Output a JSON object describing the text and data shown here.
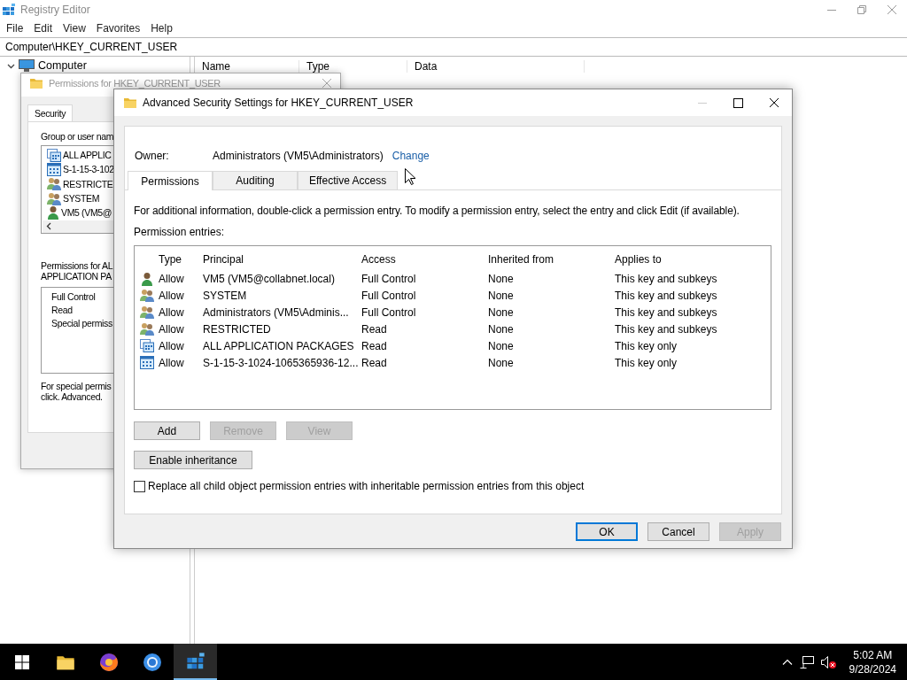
{
  "registry_editor": {
    "title": "Registry Editor",
    "menu": [
      "File",
      "Edit",
      "View",
      "Favorites",
      "Help"
    ],
    "address": "Computer\\HKEY_CURRENT_USER",
    "tree": [
      {
        "label": "Computer",
        "expanded": true
      }
    ],
    "columns": [
      "Name",
      "Type",
      "Data"
    ]
  },
  "permissions_dialog": {
    "title": "Permissions for HKEY_CURRENT_USER",
    "tabs": [
      {
        "label": "Security",
        "selected": true
      }
    ],
    "group_label": "Group or user nam",
    "principals": [
      {
        "name": "ALL APPLIC",
        "kind": "package"
      },
      {
        "name": "S-1-15-3-102",
        "kind": "capability"
      },
      {
        "name": "RESTRICTE",
        "kind": "group"
      },
      {
        "name": "SYSTEM",
        "kind": "group"
      },
      {
        "name": "VM5 (VM5@",
        "kind": "user"
      }
    ],
    "permissions_label": [
      "Permissions for AL",
      "APPLICATION PA"
    ],
    "permissions": [
      "Full Control",
      "Read",
      "Special permiss"
    ],
    "note": [
      "For special permis",
      "click. Advanced."
    ]
  },
  "advanced_dialog": {
    "title": "Advanced Security Settings for HKEY_CURRENT_USER",
    "owner_label": "Owner:",
    "owner": "Administrators (VM5\\Administrators)",
    "owner_link": "Change",
    "tabs": [
      {
        "label": "Permissions",
        "selected": true
      },
      {
        "label": "Auditing",
        "selected": false
      },
      {
        "label": "Effective Access",
        "selected": false
      }
    ],
    "info": "For additional information, double-click a permission entry. To modify a permission entry, select the entry and click Edit (if available).",
    "entries_label": "Permission entries:",
    "columns": [
      "Type",
      "Principal",
      "Access",
      "Inherited from",
      "Applies to"
    ],
    "entries": [
      {
        "kind": "user",
        "type": "Allow",
        "principal": "VM5 (VM5@collabnet.local)",
        "access": "Full Control",
        "inherited_from": "None",
        "applies_to": "This key and subkeys"
      },
      {
        "kind": "group",
        "type": "Allow",
        "principal": "SYSTEM",
        "access": "Full Control",
        "inherited_from": "None",
        "applies_to": "This key and subkeys"
      },
      {
        "kind": "group",
        "type": "Allow",
        "principal": "Administrators (VM5\\Adminis...",
        "access": "Full Control",
        "inherited_from": "None",
        "applies_to": "This key and subkeys"
      },
      {
        "kind": "group",
        "type": "Allow",
        "principal": "RESTRICTED",
        "access": "Read",
        "inherited_from": "None",
        "applies_to": "This key and subkeys"
      },
      {
        "kind": "package",
        "type": "Allow",
        "principal": "ALL APPLICATION PACKAGES",
        "access": "Read",
        "inherited_from": "None",
        "applies_to": "This key only"
      },
      {
        "kind": "capability",
        "type": "Allow",
        "principal": "S-1-15-3-1024-1065365936-12...",
        "access": "Read",
        "inherited_from": "None",
        "applies_to": "This key only"
      }
    ],
    "entry_buttons": [
      {
        "label": "Add",
        "disabled": false
      },
      {
        "label": "Remove",
        "disabled": true
      },
      {
        "label": "View",
        "disabled": true
      }
    ],
    "inheritance_button": "Enable inheritance",
    "replace_checkbox": {
      "label": "Replace all child object permission entries with inheritable permission entries from this object",
      "checked": false
    },
    "footer_buttons": [
      {
        "label": "OK",
        "disabled": false,
        "default": true
      },
      {
        "label": "Cancel",
        "disabled": false,
        "default": false
      },
      {
        "label": "Apply",
        "disabled": true,
        "default": false
      }
    ]
  },
  "taskbar": {
    "apps": [
      {
        "kind": "folder",
        "selected": false
      },
      {
        "kind": "firefox",
        "selected": false
      },
      {
        "kind": "chrome",
        "selected": false
      },
      {
        "kind": "regedit",
        "selected": true
      }
    ],
    "time": "5:02 AM",
    "date": "9/28/2024"
  }
}
